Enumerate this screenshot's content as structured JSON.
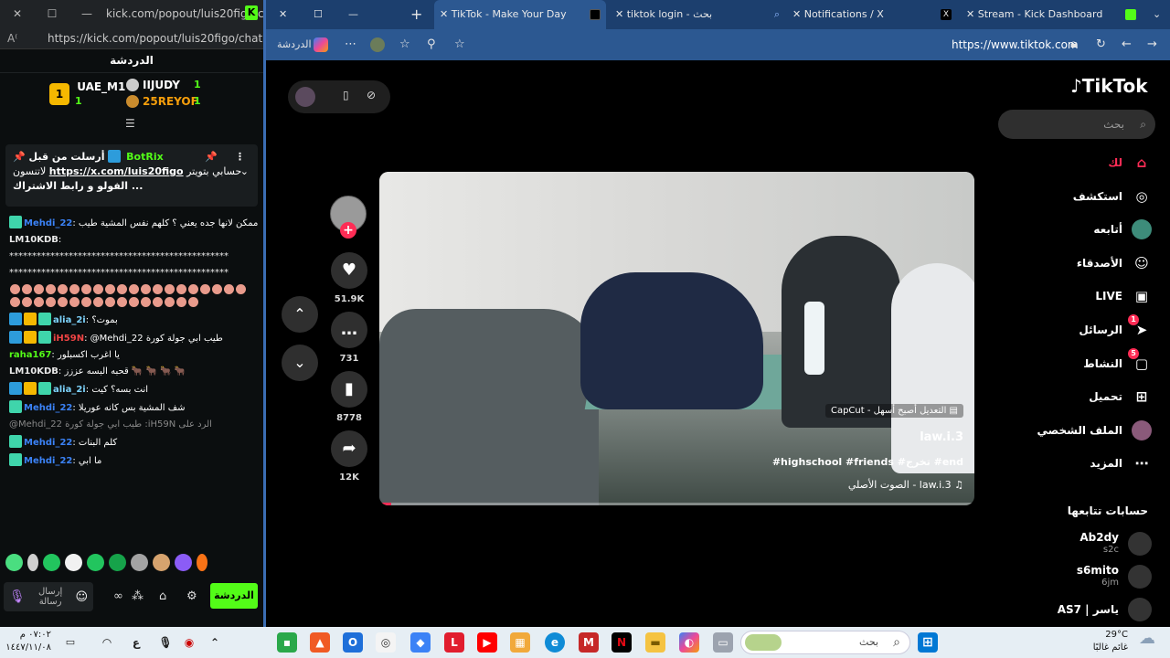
{
  "kick": {
    "window_title": "kick.com/popout/luis20figo/chat",
    "url": "https://kick.com/popout/luis20figo/chat",
    "header": "الدردشة",
    "leaderboard": [
      {
        "rank": "1",
        "name": "UAE_M1",
        "count": "1"
      },
      {
        "rank": "",
        "name": "IIJUDY",
        "count": "1"
      },
      {
        "rank": "",
        "name": "25REYOF",
        "count": "1"
      }
    ],
    "pinned": {
      "sender_label": "أرسلت من قبل",
      "sender": "BotRix",
      "link": "https://x.com/luis20figo",
      "text_before": "لاتنسون",
      "text_after": "حسابي بتويتر",
      "line2": "الفولو و رابط الاشتراك ..."
    },
    "messages": [
      {
        "user": "Mehdi_22",
        "text": "ممكن لانها جده يعني ؟ كلهم نفس المشية طيب",
        "color": "#3b82f6",
        "badges": [
          "v"
        ]
      },
      {
        "user": "LM10KDB",
        "text": "",
        "color": "#e8e8e8",
        "badges": []
      },
      {
        "user": "",
        "text": "************************************************",
        "color": "#e8e8e8",
        "badges": []
      },
      {
        "user": "",
        "text": "************************************************",
        "color": "#e8e8e8",
        "badges": []
      },
      {
        "user": "alia_2i",
        "text": "بموت؟",
        "color": "#7dd3fc",
        "badges": [
          "a",
          "c",
          "v"
        ]
      },
      {
        "user": "iH59N",
        "text": "@Mehdi_22 طيب ابي جولة كورة",
        "color": "#ef4444",
        "badges": [
          "a",
          "c",
          "v"
        ]
      },
      {
        "user": "raha167",
        "text": "يا اغرب اكسبلور",
        "color": "#53fc18",
        "badges": []
      },
      {
        "user": "LM10KDB",
        "text": "قحبه البسه عززز 🐂 🐂 🐂 🐂",
        "color": "#e8e8e8",
        "badges": []
      },
      {
        "user": "alia_2i",
        "text": "انت بسه؟ كيت",
        "color": "#7dd3fc",
        "badges": [
          "a",
          "c",
          "v"
        ]
      },
      {
        "user": "Mehdi_22",
        "text": "شف المشية بس كانه عوريلا",
        "color": "#3b82f6",
        "badges": [
          "v"
        ]
      },
      {
        "user": "",
        "text": "@Mehdi_22 طيب ابي جولة كورة :iH59N الرد على",
        "color": "#888888",
        "badges": []
      },
      {
        "user": "Mehdi_22",
        "text": "كلم البنات",
        "color": "#3b82f6",
        "badges": [
          "v"
        ]
      },
      {
        "user": "Mehdi_22",
        "text": "ما ابي",
        "color": "#3b82f6",
        "badges": [
          "v"
        ]
      }
    ],
    "send_placeholder": "إرسال رسالة",
    "chat_button": "الدردشة"
  },
  "edge": {
    "tabs": [
      {
        "label": "TikTok - Make Your Day",
        "active": true
      },
      {
        "label": "tiktok login - بحث",
        "active": false
      },
      {
        "label": "Notifications / X",
        "active": false
      },
      {
        "label": "Stream - Kick Dashboard",
        "active": false
      }
    ],
    "url": "https://www.tiktok.com",
    "copilot_label": "الدردشة"
  },
  "tiktok": {
    "logo": "TikTok",
    "search_placeholder": "بحث",
    "nav": [
      {
        "label": "لك",
        "icon": "home-icon"
      },
      {
        "label": "استكشف",
        "icon": "compass-icon"
      },
      {
        "label": "أتابعه",
        "icon": "following-icon"
      },
      {
        "label": "الأصدقاء",
        "icon": "friends-icon"
      },
      {
        "label": "LIVE",
        "icon": "live-icon"
      },
      {
        "label": "الرسائل",
        "icon": "messages-icon",
        "badge": "1"
      },
      {
        "label": "النشاط",
        "icon": "activity-icon",
        "badge": "5"
      },
      {
        "label": "تحميل",
        "icon": "upload-icon"
      },
      {
        "label": "الملف الشخصي",
        "icon": "profile-icon"
      },
      {
        "label": "المزيد",
        "icon": "more-icon"
      }
    ],
    "following_title": "حسابات تتابعها",
    "following": [
      {
        "name": "Ab2dy",
        "sub": "s2c"
      },
      {
        "name": "s6mito",
        "sub": "6jm"
      },
      {
        "name": "AS7 | ياسر",
        "sub": ""
      }
    ],
    "video": {
      "capcut": "CapCut - التعديل أصبح أسهل",
      "author": "law.i.3",
      "tags": "#highschool #friends #تخرج #end",
      "sound": "الصوت الأصلي - law.i.3",
      "progress": 0.02
    },
    "actions": {
      "likes": "51.9K",
      "comments": "731",
      "saves": "8778",
      "shares": "12K"
    }
  },
  "taskbar": {
    "time": "٠٧:٠٢ م",
    "date": "١٤٤٧/١١/٠٨",
    "lang": "ع",
    "search_placeholder": "بحث",
    "temp": "29°C",
    "weather": "غائم غالبًا"
  }
}
